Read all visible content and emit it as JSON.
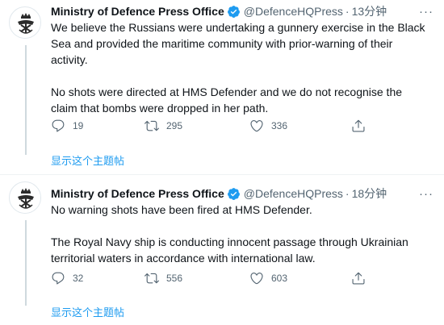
{
  "tweets": [
    {
      "author_name": "Ministry of Defence Press Office",
      "handle": "@DefenceHQPress",
      "separator": "·",
      "time": "13分钟",
      "paragraphs": [
        "We believe the Russians were undertaking a gunnery exercise in the Black Sea and provided the maritime community with prior-warning of their activity.",
        "No shots were directed at HMS Defender and we do not recognise the claim that bombs were dropped in her path."
      ],
      "replies": "19",
      "retweets": "295",
      "likes": "336",
      "show_thread": "显示这个主题帖"
    },
    {
      "author_name": "Ministry of Defence Press Office",
      "handle": "@DefenceHQPress",
      "separator": "·",
      "time": "18分钟",
      "paragraphs": [
        "No warning shots have been fired at HMS Defender.",
        "The Royal Navy ship is conducting innocent passage through Ukrainian territorial waters in accordance with international law."
      ],
      "replies": "32",
      "retweets": "556",
      "likes": "603",
      "show_thread": "显示这个主题帖"
    }
  ],
  "icons": {
    "avatar": "royal-crest-icon",
    "verified": "verified-badge-icon",
    "more": "more-options-icon",
    "reply": "reply-icon",
    "retweet": "retweet-icon",
    "like": "heart-icon",
    "share": "share-icon"
  },
  "colors": {
    "accent": "#1d9bf0",
    "muted_text": "#536471",
    "primary_text": "#0f1419",
    "divider": "#eff3f4"
  }
}
